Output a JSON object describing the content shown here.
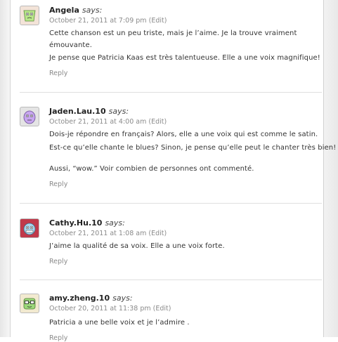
{
  "comments": [
    {
      "author": "Angela",
      "says": "says:",
      "date": "October 21, 2011 at 7:09 pm",
      "edit": "(Edit)",
      "lines": [
        "Cette chanson est un peu triste, mais je l’aime. Je la trouve vraiment",
        "émouvante.",
        "Je pense que Patricia Kaas est très talentueuse. Elle a une voix magnifique!"
      ],
      "reply": "Reply",
      "avatar_colors": {
        "bg": "#f3e3d8",
        "face": "#b9e78a"
      },
      "avatar_icon": "green-monster-icon"
    },
    {
      "author": "Jaden.Lau.10",
      "says": "says:",
      "date": "October 21, 2011 at 4:00 am",
      "edit": "(Edit)",
      "lines": [
        "Dois-je répondre en français? Alors, elle a une voix qui est comme le satin.",
        "Est-ce qu’elle chante le blues? Sinon, je pense qu’elle peut le chanter très bien!",
        "Aussi, “wow.” Voir combien de personnes ont commenté."
      ],
      "reply": "Reply",
      "avatar_colors": {
        "bg": "#e4e4e4",
        "face": "#c7a6ef"
      },
      "avatar_icon": "purple-monster-icon"
    },
    {
      "author": "Cathy.Hu.10",
      "says": "says:",
      "date": "October 21, 2011 at 1:08 am",
      "edit": "(Edit)",
      "lines": [
        "J’aime la qualité de sa voix. Elle a une voix forte."
      ],
      "reply": "Reply",
      "avatar_colors": {
        "bg": "#c0394a",
        "face": "#a9d7ef"
      },
      "avatar_icon": "blue-monster-icon"
    },
    {
      "author": "amy.zheng.10",
      "says": "says:",
      "date": "October 20, 2011 at 11:38 pm",
      "edit": "(Edit)",
      "lines": [
        "Patricia a une belle voix et je l’admire ."
      ],
      "reply": "Reply",
      "avatar_colors": {
        "bg": "#f2ead0",
        "face": "#9bd77a"
      },
      "avatar_icon": "green-glasses-monster-icon"
    }
  ]
}
